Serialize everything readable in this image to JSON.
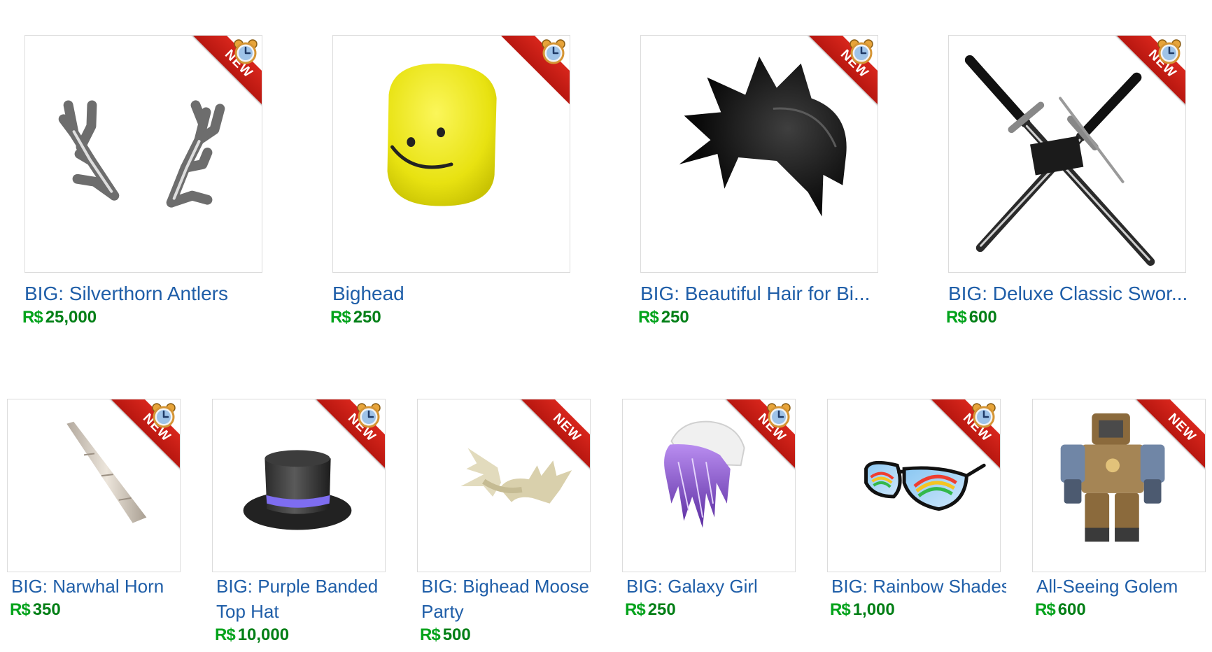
{
  "currency_symbol": "R$",
  "badge_text": "NEW",
  "items": [
    {
      "name": "BIG: Silverthorn Antlers",
      "price": "25,000",
      "image": "antlers-image",
      "timed": true
    },
    {
      "name": "Bighead",
      "price": "250",
      "image": "yellow-head-image",
      "timed": true
    },
    {
      "name": "BIG: Beautiful Hair for Bi...",
      "price": "250",
      "image": "black-hair-image",
      "timed": true
    },
    {
      "name": "BIG: Deluxe Classic Swor...",
      "price": "600",
      "image": "crossed-swords-image",
      "timed": true
    },
    {
      "name": "BIG: Narwhal Horn",
      "price": "350",
      "image": "narwhal-horn-image",
      "timed": true
    },
    {
      "name": "BIG: Purple Banded Top Hat",
      "name_lines": [
        "BIG: Purple Banded",
        "Top Hat"
      ],
      "price": "10,000",
      "image": "top-hat-image",
      "timed": true
    },
    {
      "name": "BIG: Bighead Moose Party",
      "name_lines": [
        "BIG: Bighead Moose",
        "Party"
      ],
      "price": "500",
      "image": "moose-antlers-image",
      "timed": false
    },
    {
      "name": "BIG: Galaxy Girl",
      "price": "250",
      "image": "galaxy-hair-image",
      "timed": true
    },
    {
      "name": "BIG: Rainbow Shades",
      "price": "1,000",
      "image": "rainbow-shades-image",
      "timed": true
    },
    {
      "name": "All-Seeing Golem",
      "price": "600",
      "image": "golem-image",
      "timed": false
    }
  ],
  "colors": {
    "link": "#1f5ea8",
    "price": "#027f16",
    "ribbon": "#c81d14"
  }
}
